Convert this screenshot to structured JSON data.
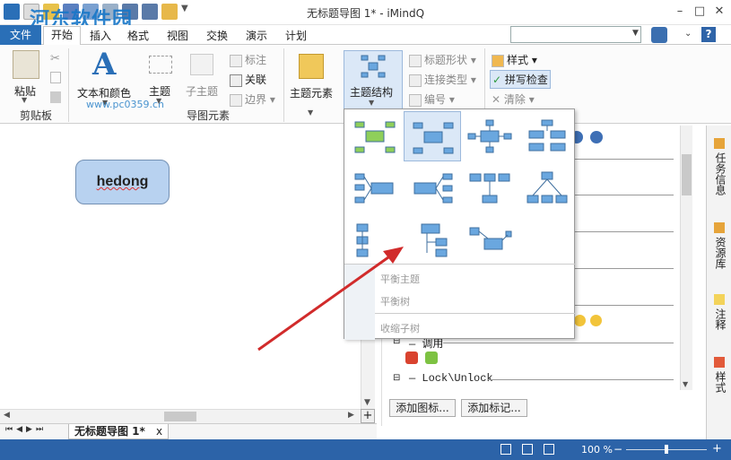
{
  "window": {
    "title": "无标题导图 1* - iMindQ"
  },
  "watermark": {
    "site": "河东软件园",
    "url": "www.pc0359.cn"
  },
  "menu": {
    "file": "文件",
    "items": [
      "开始",
      "插入",
      "格式",
      "视图",
      "交换",
      "演示",
      "计划"
    ],
    "active_index": 0
  },
  "ribbon": {
    "paste": "粘贴",
    "clipboard_group": "剪贴板",
    "text_color": "文本和颜色",
    "topic": "主题",
    "subtopic": "子主题",
    "callout": "标注",
    "relation": "关联",
    "boundary": "边界",
    "map_elements_group": "导图元素",
    "topic_elements": "主题元素",
    "topic_structure": "主题结构",
    "topic_shape": "标题形状",
    "line_type": "连接类型",
    "numbering": "编号",
    "style": "样式",
    "spell_check": "拼写检查",
    "clear": "清除"
  },
  "canvas": {
    "topic_text": "hedong"
  },
  "tab": {
    "label": "无标题导图 1*",
    "close": "x"
  },
  "dropdown": {
    "balanced_topic": "平衡主题",
    "balanced_tree": "平衡树",
    "collapse_children": "收缩子树"
  },
  "panel": {
    "line1": "调用",
    "line2": "Lock\\Unlock",
    "add_icon": "添加图标...",
    "add_marker": "添加标记..."
  },
  "side_tabs": [
    "任务信息",
    "资源库",
    "注释",
    "样式"
  ],
  "status": {
    "zoom": "100 %"
  },
  "colors": {
    "accent": "#2c63a8",
    "topic_fill": "#b8d2f0",
    "structure_green": "#8fcf5a",
    "structure_blue": "#6aa7df"
  }
}
